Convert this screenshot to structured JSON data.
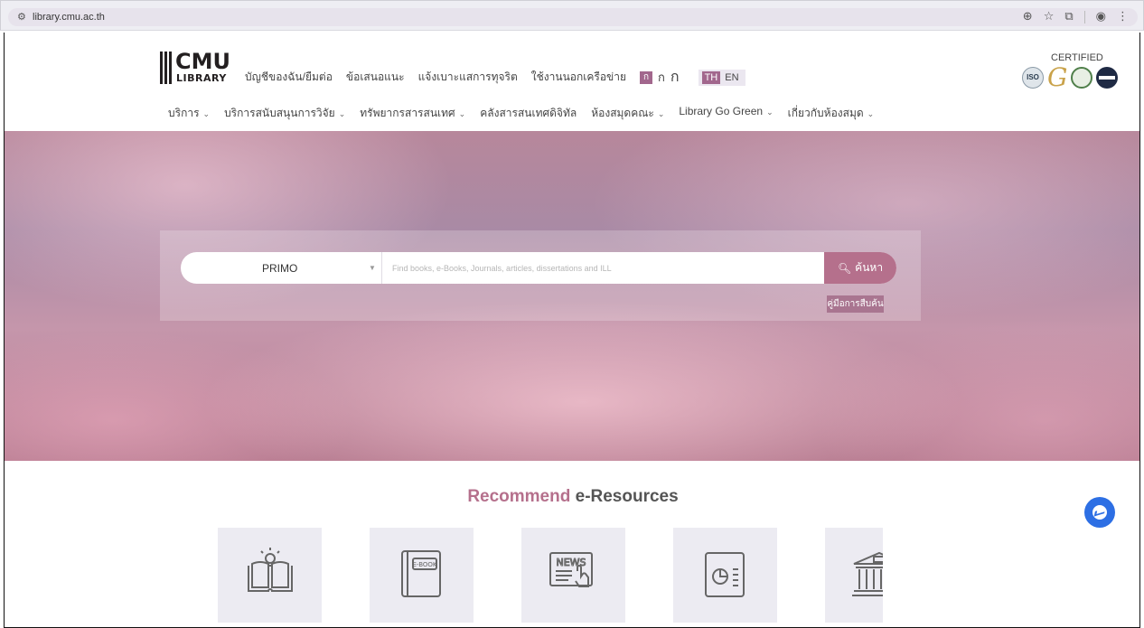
{
  "browser": {
    "url": "library.cmu.ac.th",
    "icons": [
      "site-info-icon",
      "zoom-icon",
      "bookmark-star-icon",
      "extensions-icon",
      "profile-avatar-icon",
      "menu-icon"
    ]
  },
  "header": {
    "logo_text": "CMU",
    "logo_sub": "LIBRARY",
    "top_links": [
      "บัญชีของฉัน/ยืมต่อ",
      "ข้อเสนอแนะ",
      "แจ้งเบาะแสการทุจริต",
      "ใช้งานนอกเครือข่าย"
    ],
    "font_sizes": [
      "ก",
      "ก",
      "ก"
    ],
    "lang": {
      "th": "TH",
      "en": "EN"
    },
    "certified": "CERTIFIED",
    "iso": "ISO",
    "g_mark": "G"
  },
  "nav": [
    {
      "label": "บริการ",
      "dropdown": true
    },
    {
      "label": "บริการสนับสนุนการวิจัย",
      "dropdown": true
    },
    {
      "label": "ทรัพยากรสารสนเทศ",
      "dropdown": true
    },
    {
      "label": "คลังสารสนเทศดิจิทัล",
      "dropdown": false
    },
    {
      "label": "ห้องสมุดคณะ",
      "dropdown": true
    },
    {
      "label": "Library Go Green",
      "dropdown": true
    },
    {
      "label": "เกี่ยวกับห้องสมุด",
      "dropdown": true
    }
  ],
  "search": {
    "source": "PRIMO",
    "placeholder": "Find books, e-Books, Journals, articles, dissertations and ILL",
    "button": "ค้นหา",
    "guide": "คู่มือการสืบค้น"
  },
  "recommend": {
    "title_accent": "Recommend",
    "title_rest": " e-Resources",
    "card_icons": [
      "book-idea-icon",
      "ebook-icon",
      "news-icon",
      "report-icon",
      "library-building-icon"
    ],
    "ebook_text": "E-BOOK",
    "news_text": "NEWS"
  },
  "colors": {
    "accent": "#b5708c",
    "card_bg": "#ecebf2",
    "messenger": "#2d6fe4"
  }
}
